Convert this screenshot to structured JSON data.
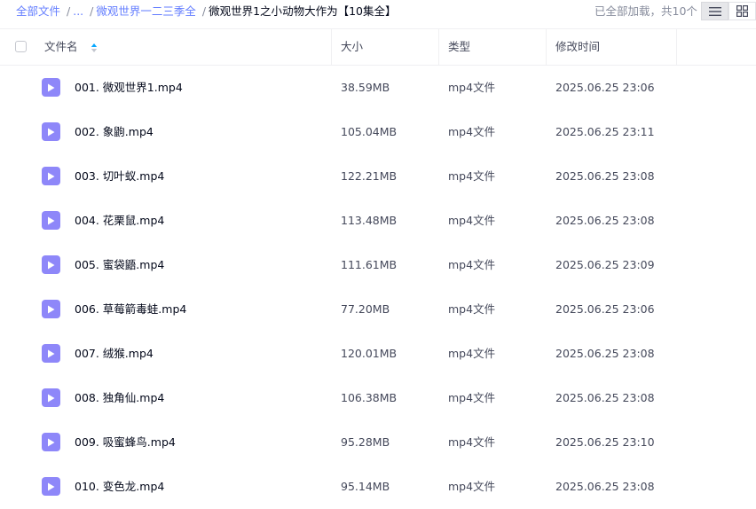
{
  "breadcrumb": {
    "items": [
      "全部文件",
      "...",
      "微观世界一二三季全"
    ],
    "current": "微观世界1之小动物大作为【10集全】"
  },
  "loaded_info": "已全部加载，共10个",
  "view_toggle": {
    "list_icon": "list-view-icon",
    "grid_icon": "grid-view-icon",
    "active": "list"
  },
  "table": {
    "columns": {
      "name": "文件名",
      "size": "大小",
      "type": "类型",
      "modified": "修改时间"
    },
    "sort_icon": "sort-asc-icon",
    "file_icon": "video-file-icon",
    "rows": [
      {
        "name": "001. 微观世界1.mp4",
        "size": "38.59MB",
        "type": "mp4文件",
        "modified": "2025.06.25 23:06"
      },
      {
        "name": "002. 象鼩.mp4",
        "size": "105.04MB",
        "type": "mp4文件",
        "modified": "2025.06.25 23:11"
      },
      {
        "name": "003. 切叶蚁.mp4",
        "size": "122.21MB",
        "type": "mp4文件",
        "modified": "2025.06.25 23:08"
      },
      {
        "name": "004. 花栗鼠.mp4",
        "size": "113.48MB",
        "type": "mp4文件",
        "modified": "2025.06.25 23:08"
      },
      {
        "name": "005. 蜜袋鼯.mp4",
        "size": "111.61MB",
        "type": "mp4文件",
        "modified": "2025.06.25 23:09"
      },
      {
        "name": "006. 草莓箭毒蛙.mp4",
        "size": "77.20MB",
        "type": "mp4文件",
        "modified": "2025.06.25 23:06"
      },
      {
        "name": "007. 绒猴.mp4",
        "size": "120.01MB",
        "type": "mp4文件",
        "modified": "2025.06.25 23:08"
      },
      {
        "name": "008. 独角仙.mp4",
        "size": "106.38MB",
        "type": "mp4文件",
        "modified": "2025.06.25 23:08"
      },
      {
        "name": "009. 吸蜜蜂鸟.mp4",
        "size": "95.28MB",
        "type": "mp4文件",
        "modified": "2025.06.25 23:10"
      },
      {
        "name": "010. 变色龙.mp4",
        "size": "95.14MB",
        "type": "mp4文件",
        "modified": "2025.06.25 23:08"
      }
    ]
  },
  "colors": {
    "accent": "#637dff",
    "file_icon_bg": "#8e87f9",
    "muted_text": "#878c9c"
  }
}
